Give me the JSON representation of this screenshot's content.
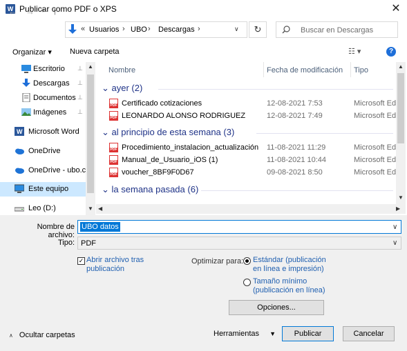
{
  "window": {
    "title": "Publicar como PDF o XPS",
    "app_icon": "W",
    "close_glyph": "✕"
  },
  "nav": {
    "back_glyph": "←",
    "forward_glyph": "→",
    "up_glyph": "↑",
    "refresh_glyph": "↻",
    "breadcrumb_prefix": "«",
    "breadcrumbs": [
      "Usuarios",
      "UBO",
      "Descargas"
    ],
    "search_placeholder": "Buscar en Descargas"
  },
  "toolbar": {
    "organize": "Organizar ▾",
    "new_folder": "Nueva carpeta",
    "view_glyph": "☷ ▾",
    "help_glyph": "?"
  },
  "sidebar": {
    "items": [
      {
        "label": "Escritorio",
        "icon": "desktop-icon",
        "pinned": true
      },
      {
        "label": "Descargas",
        "icon": "downloads-icon",
        "pinned": true
      },
      {
        "label": "Documentos",
        "icon": "documents-icon",
        "pinned": true
      },
      {
        "label": "Imágenes",
        "icon": "pictures-icon",
        "pinned": true
      },
      {
        "label": "Microsoft Word",
        "icon": "word-icon",
        "pinned": false
      },
      {
        "label": "OneDrive",
        "icon": "onedrive-icon",
        "pinned": false
      },
      {
        "label": "OneDrive - ubo.cl",
        "icon": "onedrive-icon",
        "pinned": false
      },
      {
        "label": "Este equipo",
        "icon": "computer-icon",
        "pinned": false,
        "selected": true
      },
      {
        "label": "Leo (D:)",
        "icon": "drive-icon",
        "pinned": false
      }
    ],
    "pin_glyph": "📌"
  },
  "filelist": {
    "columns": [
      "Nombre",
      "Fecha de modificación",
      "Tipo"
    ],
    "groups": [
      {
        "label": "ayer (2)",
        "files": [
          {
            "name": "Certificado cotizaciones",
            "date": "12-08-2021 7:53",
            "type": "Microsoft Ed"
          },
          {
            "name": "LEONARDO ALONSO RODRIGUEZ",
            "date": "12-08-2021 7:49",
            "type": "Microsoft Ed"
          }
        ]
      },
      {
        "label": "al principio de esta semana (3)",
        "files": [
          {
            "name": "Procedimiento_instalacion_actualización...",
            "date": "11-08-2021 11:29",
            "type": "Microsoft Ed"
          },
          {
            "name": "Manual_de_Usuario_iOS (1)",
            "date": "11-08-2021 10:44",
            "type": "Microsoft Ed"
          },
          {
            "name": "voucher_8BF9F0D67",
            "date": "09-08-2021 8:50",
            "type": "Microsoft Ed"
          }
        ]
      },
      {
        "label": "la semana pasada (6)",
        "files": []
      }
    ]
  },
  "form": {
    "filename_label": "Nombre de archivo:",
    "filename_value": "UBO datos",
    "filetype_label": "Tipo:",
    "filetype_value": "PDF",
    "open_after_label": "Abrir archivo tras publicación",
    "open_after_checked": true,
    "optimize_label": "Optimizar para:",
    "optimize_options": [
      {
        "label": "Estándar (publicación en línea e impresión)",
        "selected": true
      },
      {
        "label": "Tamaño mínimo (publicación en línea)",
        "selected": false
      }
    ],
    "options_button": "Opciones..."
  },
  "footer": {
    "hide_folders": "Ocultar carpetas",
    "tools": "Herramientas",
    "publish": "Publicar",
    "cancel": "Cancelar"
  },
  "colors": {
    "accent": "#0078d7",
    "group_header": "#1e3287",
    "link_blue": "#1f5fb0",
    "selected_bg": "#cce8ff",
    "pdf_red": "#d33"
  }
}
